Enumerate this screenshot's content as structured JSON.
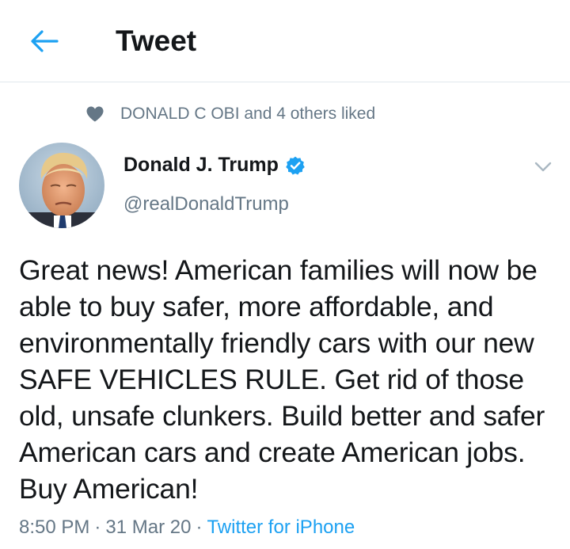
{
  "header": {
    "title": "Tweet",
    "back_icon": "arrow-left-icon",
    "accent_color": "#1da1f2"
  },
  "social_context": {
    "icon": "heart-icon",
    "text": "DONALD C OBI and 4 others liked"
  },
  "tweet": {
    "author_name": "Donald J. Trump",
    "verified_icon": "verified-badge-icon",
    "handle": "@realDonaldTrump",
    "menu_icon": "chevron-down-icon",
    "text": "Great news! American families will now be able to buy safer, more affordable, and environmentally friendly cars with our new SAFE VEHICLES RULE. Get rid of those old, unsafe clunkers. Build better and safer American cars and create American jobs. Buy American!",
    "time": "8:50 PM",
    "separator": "·",
    "date": "31 Mar 20",
    "source": "Twitter for iPhone"
  }
}
